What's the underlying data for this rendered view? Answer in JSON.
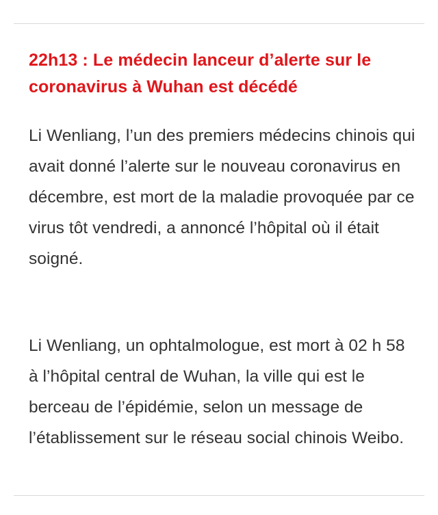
{
  "article": {
    "headline": "22h13 : Le médecin lanceur d’alerte sur le coronavirus à Wuhan est décédé",
    "paragraphs": [
      "Li Wenliang, l’un des premiers médecins chinois qui avait donné l’alerte sur le nouveau coronavirus en décembre, est mort de la maladie provoquée par ce virus tôt vendredi, a annoncé l’hôpital où il était soigné.",
      "Li Wenliang, un ophtalmologue, est mort à 02 h 58 à l’hôpital central de Wuhan, la ville qui est le berceau de l’épidémie, selon un message de l’établissement sur le réseau social chinois Weibo."
    ]
  },
  "colors": {
    "headline": "#e0161a",
    "body_text": "#333333",
    "divider": "#d9d9d9",
    "background": "#ffffff"
  }
}
